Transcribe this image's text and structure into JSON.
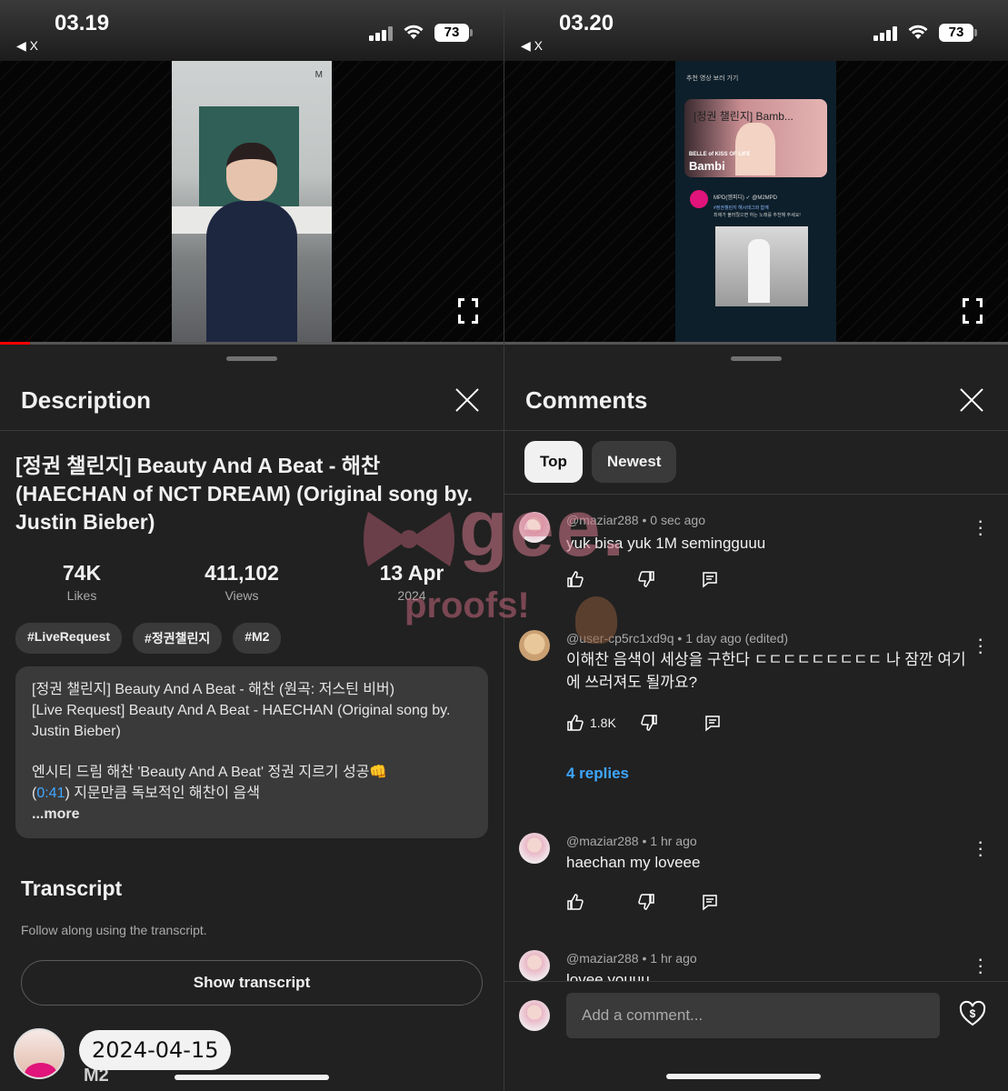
{
  "left": {
    "status": {
      "time": "03.19",
      "back": "◀ X",
      "battery": "73"
    },
    "video_logo": "M",
    "sheet_title": "Description",
    "video_title": "[정권 챌린지] Beauty And A Beat - 해찬 (HAECHAN of NCT DREAM) (Original song by. Justin Bieber)",
    "stats": [
      {
        "value": "74K",
        "label": "Likes"
      },
      {
        "value": "411,102",
        "label": "Views"
      },
      {
        "value": "13 Apr",
        "label": "2024"
      }
    ],
    "tags": [
      "#LiveRequest",
      "#정권챌린지",
      "#M2"
    ],
    "description": {
      "line1": "[정권 챌린지] Beauty And A Beat - 해찬 (원곡: 저스틴 비버)",
      "line2": "[Live Request] Beauty And A Beat - HAECHAN (Original song by. Justin Bieber)",
      "line3": "엔시티 드림 해찬 'Beauty And A Beat' 정권 지르기 성공👊",
      "timestamp": "0:41",
      "line4_rest": " 지문만큼 독보적인 해찬이 음색",
      "more": "...more"
    },
    "transcript": {
      "heading": "Transcript",
      "sub": "Follow along using the transcript.",
      "button": "Show transcript"
    },
    "channel_name": "M2",
    "date_overlay": "2024-04-15",
    "progress": 0.06
  },
  "right": {
    "status": {
      "time": "03.20",
      "back": "◀ X",
      "battery": "73"
    },
    "sheet_title": "Comments",
    "chips": [
      "Top",
      "Newest"
    ],
    "video_card": {
      "header": "추천 영상 보러 가기",
      "thumb_title": "[정권 챌린지] Bamb...",
      "thumb_sub": "BELLE of KISS OF LIFE",
      "thumb_song": "Bambi",
      "post_name": "MPD(엠피디) ✓ @M2MPD",
      "post_line1": "#정권챌린지 해시태그와 함께",
      "post_line2": "최애가 불러줬으면 하는 노래를 추천해 주세요!"
    },
    "comments": [
      {
        "user": "@maziar288",
        "time": "0 sec ago",
        "text": "yuk bisa yuk 1M semingguuu",
        "likes": "",
        "avatar": "pink"
      },
      {
        "user": "@user-cp5rc1xd9q",
        "time": "1 day ago (edited)",
        "text": "이해찬 음색이 세상을 구한다 ㄷㄷㄷㄷㄷㄷㄷㄷㄷ 나 잠깐 여기에 쓰러져도 될까요?",
        "likes": "1.8K",
        "avatar": "dog",
        "replies": "4 replies"
      },
      {
        "user": "@maziar288",
        "time": "1 hr ago",
        "text": "haechan my loveee",
        "likes": "",
        "avatar": "pink"
      },
      {
        "user": "@maziar288",
        "time": "1 hr ago",
        "text": "lovee youuu",
        "likes": "",
        "avatar": "pink"
      }
    ],
    "add_comment_placeholder": "Add a comment...",
    "progress": 0.88
  },
  "watermark": {
    "word1": "gee.",
    "word2": "proofs!"
  },
  "colors": {
    "background": "#0f0f0f",
    "sheet": "#212121",
    "chip": "#3a3a3a",
    "link": "#3ea6ff",
    "progress": "#ff0000"
  }
}
